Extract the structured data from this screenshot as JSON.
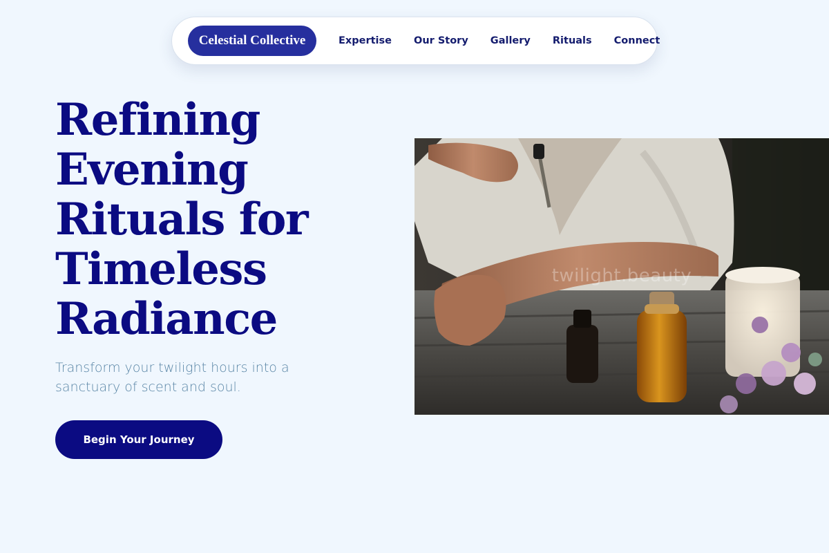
{
  "nav": {
    "brand": "Celestial Collective",
    "links": [
      "Expertise",
      "Our Story",
      "Gallery",
      "Rituals",
      "Connect"
    ]
  },
  "hero": {
    "title_lines": [
      "Refining",
      "Evening",
      "Rituals for",
      "Timeless",
      "Radiance"
    ],
    "subtitle": "Transform your twilight hours into a sanctuary of scent and soul.",
    "cta_label": "Begin Your Journey",
    "image_watermark": "twilight.beauty"
  },
  "colors": {
    "background": "#f0f7fe",
    "primary_navy": "#0b0b82",
    "brand_pill": "#262f9e",
    "subtitle": "#5a86a6"
  }
}
